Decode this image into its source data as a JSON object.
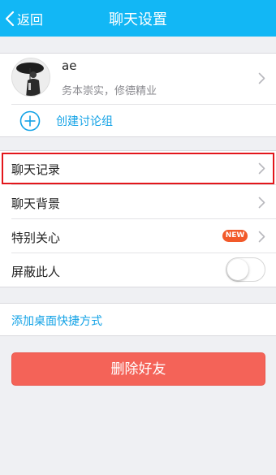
{
  "header": {
    "back_label": "返回",
    "title": "聊天设置",
    "background": "#12b7f5"
  },
  "profile": {
    "nickname": "ae",
    "signature": "务本崇实，修德精业",
    "create_group_label": "创建讨论组"
  },
  "settings": {
    "items": [
      {
        "label": "聊天记录",
        "highlighted": true
      },
      {
        "label": "聊天背景"
      },
      {
        "label": "特别关心",
        "badge": "NEW"
      },
      {
        "label": "屏蔽此人",
        "toggle_on": false
      }
    ]
  },
  "shortcut": {
    "label": "添加桌面快捷方式"
  },
  "delete_button": {
    "label": "删除好友",
    "color": "#f46358"
  },
  "colors": {
    "accent": "#12a2e6",
    "highlight_border": "#e3161b",
    "badge": "#f25a2a"
  }
}
